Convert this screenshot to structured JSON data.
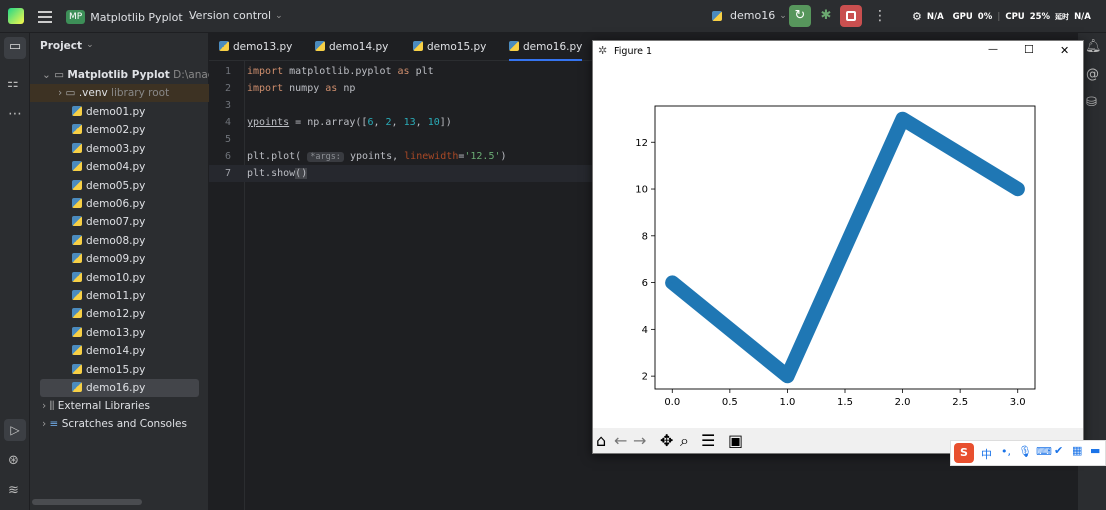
{
  "topbar": {
    "project_badge": "MP",
    "project_name": "Matplotlib Pyplot",
    "vcs": "Version control",
    "run_config": "demo16",
    "gpu_label": "GPU",
    "gpu_value": "0%",
    "cpu_label": "CPU",
    "cpu_value": "25%",
    "mem_label": "N/A",
    "net_label": "N/A",
    "net_sub": "延时"
  },
  "project_panel": {
    "title": "Project",
    "root_name": "Matplotlib Pyplot",
    "root_path": "D:\\anacond",
    "venv_name": ".venv",
    "venv_tag": "library root",
    "files": [
      "demo01.py",
      "demo02.py",
      "demo03.py",
      "demo04.py",
      "demo05.py",
      "demo06.py",
      "demo07.py",
      "demo08.py",
      "demo09.py",
      "demo10.py",
      "demo11.py",
      "demo12.py",
      "demo13.py",
      "demo14.py",
      "demo15.py",
      "demo16.py"
    ],
    "selected": "demo16.py",
    "external_libraries": "External Libraries",
    "scratches": "Scratches and Consoles"
  },
  "tabs": [
    "demo13.py",
    "demo14.py",
    "demo15.py",
    "demo16.py"
  ],
  "active_tab": "demo16.py",
  "editor": {
    "line_numbers": [
      "1",
      "2",
      "3",
      "4",
      "5",
      "6",
      "7"
    ],
    "hint_args": "*args:"
  },
  "figure": {
    "window_title": "Figure 1",
    "minimize": "—",
    "maximize": "☐",
    "close": "✕"
  },
  "chart_data": {
    "type": "line",
    "x": [
      0,
      1,
      2,
      3
    ],
    "series": [
      {
        "values": [
          6,
          2,
          13,
          10
        ],
        "color": "#1f77b4",
        "linewidth": 12.5
      }
    ],
    "xticks": [
      "0.0",
      "0.5",
      "1.0",
      "1.5",
      "2.0",
      "2.5",
      "3.0"
    ],
    "xtick_values": [
      0,
      0.5,
      1,
      1.5,
      2,
      2.5,
      3
    ],
    "yticks": [
      "2",
      "4",
      "6",
      "8",
      "10",
      "12"
    ],
    "ytick_values": [
      2,
      4,
      6,
      8,
      10,
      12
    ],
    "xlim": [
      -0.15,
      3.15
    ],
    "ylim": [
      1.45,
      13.55
    ],
    "title": "",
    "xlabel": "",
    "ylabel": "",
    "grid": false
  },
  "ime": {
    "logo": "S",
    "lang": "中"
  },
  "colors": {
    "run_green": "#57965c",
    "stop_red": "#c94f4f",
    "line_blue": "#1f77b4",
    "selection": "#43454a"
  }
}
